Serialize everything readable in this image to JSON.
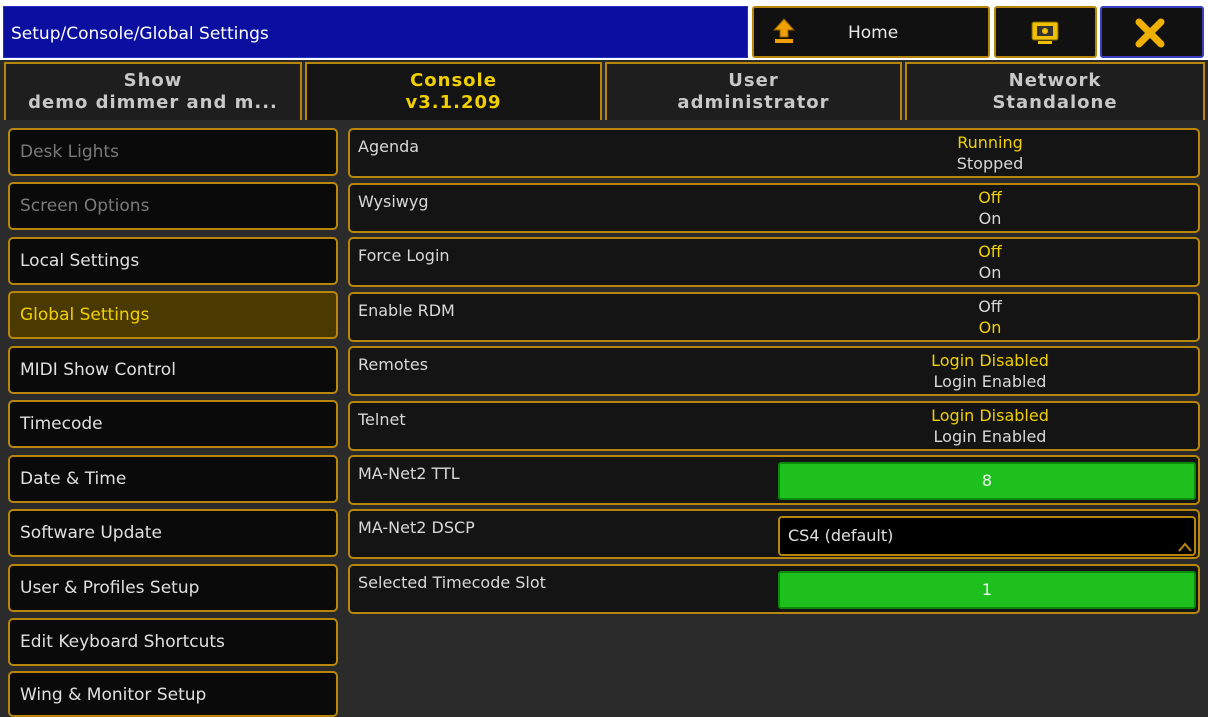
{
  "title": "Setup/Console/Global Settings",
  "home": {
    "label": "Home"
  },
  "colors": {
    "accent": "#b8860b",
    "active_text": "#f0d000",
    "title_bg": "#0b0fa0",
    "green": "#1ec01e"
  },
  "icons": {
    "home": "home-up-arrow-icon",
    "view": "screen-view-icon",
    "close": "close-x-icon"
  },
  "tabs": [
    {
      "line1": "Show",
      "line2": "demo dimmer and m...",
      "active": false
    },
    {
      "line1": "Console",
      "line2": "v3.1.209",
      "active": true
    },
    {
      "line1": "User",
      "line2": "administrator",
      "active": false
    },
    {
      "line1": "Network",
      "line2": "Standalone",
      "active": false
    }
  ],
  "sidebar": {
    "items": [
      {
        "label": "Desk Lights",
        "state": "disabled"
      },
      {
        "label": "Screen Options",
        "state": "disabled"
      },
      {
        "label": "Local Settings",
        "state": "normal"
      },
      {
        "label": "Global Settings",
        "state": "active"
      },
      {
        "label": "MIDI Show Control",
        "state": "normal"
      },
      {
        "label": "Timecode",
        "state": "normal"
      },
      {
        "label": "Date & Time",
        "state": "normal"
      },
      {
        "label": "Software Update",
        "state": "normal"
      },
      {
        "label": "User & Profiles Setup",
        "state": "normal"
      },
      {
        "label": "Edit Keyboard Shortcuts",
        "state": "normal"
      },
      {
        "label": "Wing & Monitor Setup",
        "state": "normal"
      }
    ]
  },
  "settings": [
    {
      "label": "Agenda",
      "opt_top": "Running",
      "opt_bottom": "Stopped",
      "selected": "top"
    },
    {
      "label": "Wysiwyg",
      "opt_top": "Off",
      "opt_bottom": "On",
      "selected": "top"
    },
    {
      "label": "Force Login",
      "opt_top": "Off",
      "opt_bottom": "On",
      "selected": "top"
    },
    {
      "label": "Enable RDM",
      "opt_top": "Off",
      "opt_bottom": "On",
      "selected": "bottom"
    },
    {
      "label": "Remotes",
      "opt_top": "Login Disabled",
      "opt_bottom": "Login Enabled",
      "selected": "top"
    },
    {
      "label": "Telnet",
      "opt_top": "Login Disabled",
      "opt_bottom": "Login Enabled",
      "selected": "top"
    },
    {
      "label": "MA-Net2 TTL",
      "value": "8"
    },
    {
      "label": "MA-Net2 DSCP",
      "value": "CS4 (default)"
    },
    {
      "label": "Selected Timecode Slot",
      "value": "1"
    }
  ]
}
